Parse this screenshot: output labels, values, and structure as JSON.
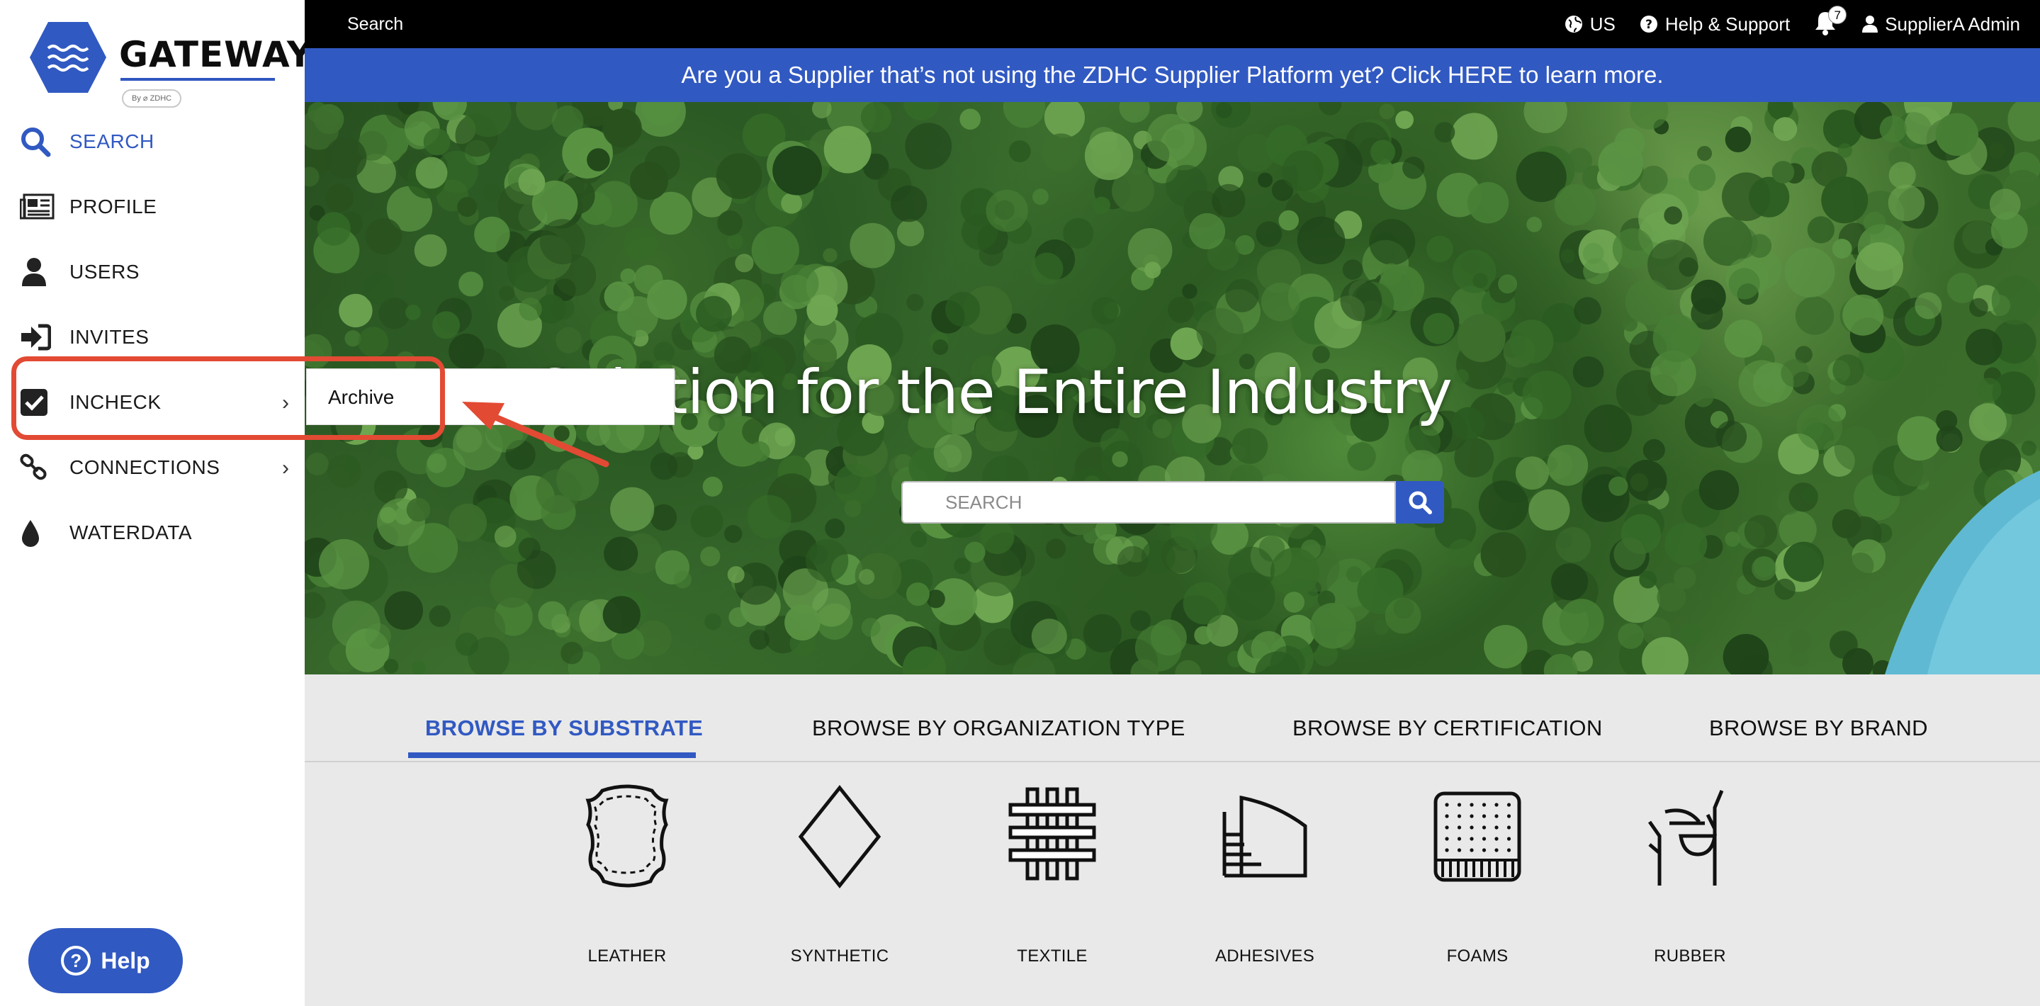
{
  "logo": {
    "word": "GATEWAY",
    "tagline": "By ⌀ ZDHC"
  },
  "sidebar": {
    "items": [
      {
        "label": "SEARCH",
        "icon": "search-icon",
        "active": true
      },
      {
        "label": "PROFILE",
        "icon": "newspaper-icon"
      },
      {
        "label": "USERS",
        "icon": "user-icon"
      },
      {
        "label": "INVITES",
        "icon": "sign-in-icon"
      },
      {
        "label": "INCHECK",
        "icon": "check-square-icon",
        "has_submenu": true
      },
      {
        "label": "CONNECTIONS",
        "icon": "link-icon",
        "has_submenu": true
      },
      {
        "label": "WATERDATA",
        "icon": "drop-icon"
      }
    ],
    "help_label": "Help"
  },
  "submenu": {
    "items": [
      "Archive"
    ]
  },
  "topbar": {
    "search_label": "Search",
    "region": "US",
    "help_support": "Help & Support",
    "notification_count": "7",
    "user": "SupplierA Admin"
  },
  "banner": {
    "text": "Are you a Supplier that’s not using the ZDHC Supplier Platform yet? Click HERE to learn more."
  },
  "hero": {
    "title": "A Solution for the Entire Industry",
    "search_placeholder": "SEARCH"
  },
  "browse": {
    "tabs": [
      "BROWSE BY SUBSTRATE",
      "BROWSE BY ORGANIZATION TYPE",
      "BROWSE BY CERTIFICATION",
      "BROWSE BY BRAND"
    ],
    "substrates": [
      "LEATHER",
      "SYNTHETIC",
      "TEXTILE",
      "ADHESIVES",
      "FOAMS",
      "RUBBER"
    ]
  },
  "colors": {
    "brand_blue": "#3159c2",
    "annotation_red": "#e24a33",
    "topbar": "#000000"
  }
}
